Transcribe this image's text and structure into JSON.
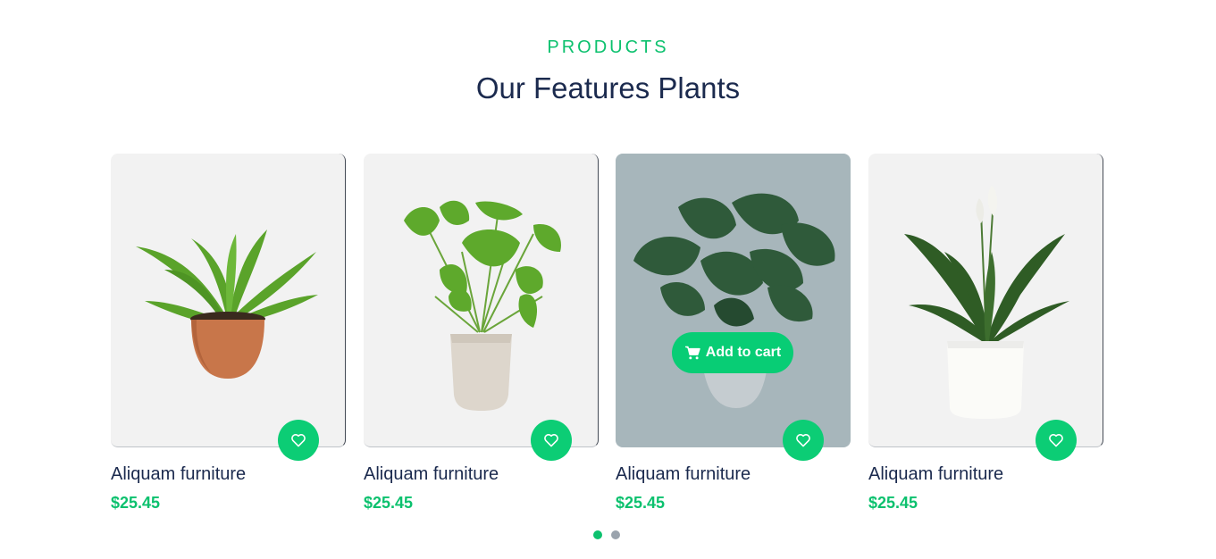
{
  "section": {
    "eyebrow": "PRODUCTS",
    "title": "Our Features Plants"
  },
  "products": [
    {
      "name": "Aliquam furniture",
      "price": "$25.45",
      "image_icon": "birds-nest-fern-in-terracotta-pot"
    },
    {
      "name": "Aliquam furniture",
      "price": "$25.45",
      "image_icon": "caladium-in-stone-pot"
    },
    {
      "name": "Aliquam furniture",
      "price": "$25.45",
      "image_icon": "monstera-in-grey-pot",
      "add_to_cart_label": "Add to cart"
    },
    {
      "name": "Aliquam furniture",
      "price": "$25.45",
      "image_icon": "peace-lily-in-white-pot"
    }
  ],
  "carousel": {
    "pages": 2,
    "active_page": 1
  },
  "colors": {
    "accent": "#0cc16e",
    "heading": "#1b2a4e",
    "card_bg": "#f2f2f2",
    "card_hover_bg": "#a7b6bb"
  }
}
